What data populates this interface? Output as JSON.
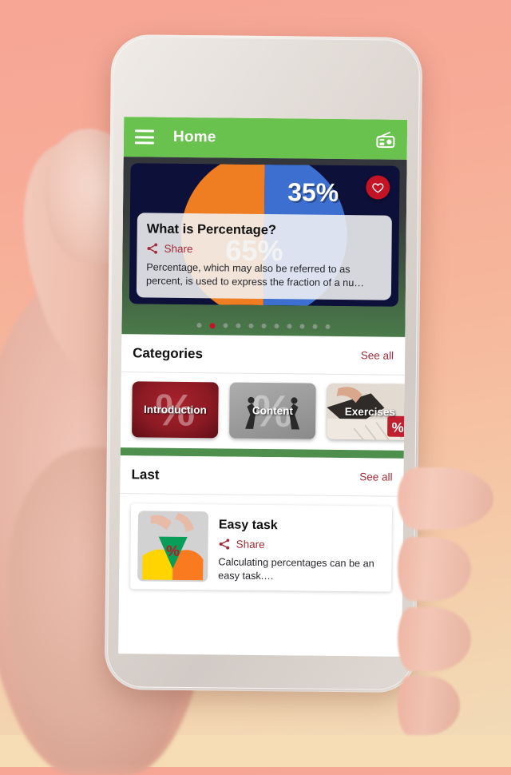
{
  "appbar": {
    "menu_icon": "hamburger-menu-icon",
    "title": "Home",
    "action_icon": "radio-icon"
  },
  "carousel": {
    "slide": {
      "badge_percent": "35%",
      "background_percent": "65%",
      "favorite_icon": "heart-icon",
      "title": "What is Percentage?",
      "share_icon": "share-icon",
      "share_label": "Share",
      "description": "Percentage, which may also be referred to as percent, is used to express the fraction of a nu…"
    },
    "dots_total": 11,
    "active_dot_index": 1
  },
  "categories": {
    "title": "Categories",
    "see_all_label": "See all",
    "items": [
      {
        "label": "Introduction",
        "ghost": "%"
      },
      {
        "label": "Content",
        "ghost": "%"
      },
      {
        "label": "Exercises",
        "ghost": "%"
      }
    ]
  },
  "last": {
    "title": "Last",
    "see_all_label": "See all",
    "items": [
      {
        "thumb_icon": "percent-pie-photo",
        "title": "Easy task",
        "share_icon": "share-icon",
        "share_label": "Share",
        "description": "Calculating percentages can be an easy task.…"
      }
    ]
  },
  "colors": {
    "appbar_green": "#69c14e",
    "accent_red": "#a32a38",
    "favorite_red": "#c31425",
    "carousel_dark": "#33363b",
    "section_divider_green": "#4f8f4d",
    "slide_navy": "#0d1038",
    "pie_orange": "#ef7d22",
    "pie_blue": "#3d6fd0",
    "background_top": "#f7a595",
    "background_bottom": "#f6ddb6"
  }
}
